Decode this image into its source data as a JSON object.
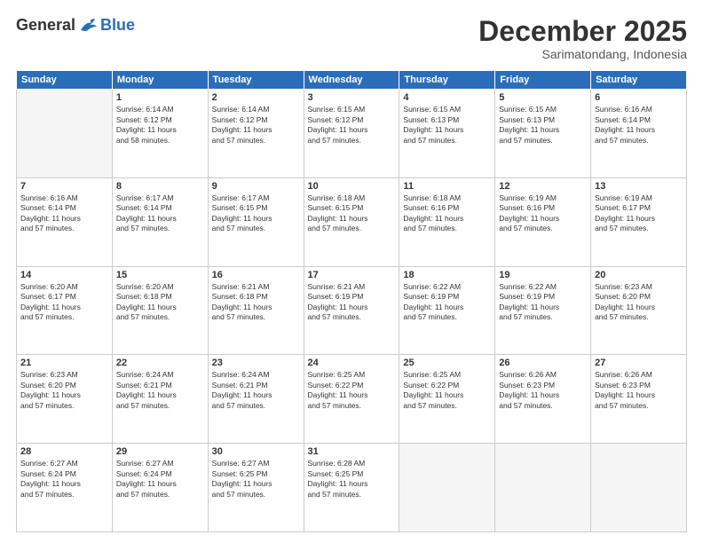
{
  "logo": {
    "general": "General",
    "blue": "Blue"
  },
  "title": "December 2025",
  "subtitle": "Sarimatondang, Indonesia",
  "weekdays": [
    "Sunday",
    "Monday",
    "Tuesday",
    "Wednesday",
    "Thursday",
    "Friday",
    "Saturday"
  ],
  "weeks": [
    [
      {
        "day": "",
        "info": ""
      },
      {
        "day": "1",
        "info": "Sunrise: 6:14 AM\nSunset: 6:12 PM\nDaylight: 11 hours\nand 58 minutes."
      },
      {
        "day": "2",
        "info": "Sunrise: 6:14 AM\nSunset: 6:12 PM\nDaylight: 11 hours\nand 57 minutes."
      },
      {
        "day": "3",
        "info": "Sunrise: 6:15 AM\nSunset: 6:12 PM\nDaylight: 11 hours\nand 57 minutes."
      },
      {
        "day": "4",
        "info": "Sunrise: 6:15 AM\nSunset: 6:13 PM\nDaylight: 11 hours\nand 57 minutes."
      },
      {
        "day": "5",
        "info": "Sunrise: 6:15 AM\nSunset: 6:13 PM\nDaylight: 11 hours\nand 57 minutes."
      },
      {
        "day": "6",
        "info": "Sunrise: 6:16 AM\nSunset: 6:14 PM\nDaylight: 11 hours\nand 57 minutes."
      }
    ],
    [
      {
        "day": "7",
        "info": "Sunrise: 6:16 AM\nSunset: 6:14 PM\nDaylight: 11 hours\nand 57 minutes."
      },
      {
        "day": "8",
        "info": "Sunrise: 6:17 AM\nSunset: 6:14 PM\nDaylight: 11 hours\nand 57 minutes."
      },
      {
        "day": "9",
        "info": "Sunrise: 6:17 AM\nSunset: 6:15 PM\nDaylight: 11 hours\nand 57 minutes."
      },
      {
        "day": "10",
        "info": "Sunrise: 6:18 AM\nSunset: 6:15 PM\nDaylight: 11 hours\nand 57 minutes."
      },
      {
        "day": "11",
        "info": "Sunrise: 6:18 AM\nSunset: 6:16 PM\nDaylight: 11 hours\nand 57 minutes."
      },
      {
        "day": "12",
        "info": "Sunrise: 6:19 AM\nSunset: 6:16 PM\nDaylight: 11 hours\nand 57 minutes."
      },
      {
        "day": "13",
        "info": "Sunrise: 6:19 AM\nSunset: 6:17 PM\nDaylight: 11 hours\nand 57 minutes."
      }
    ],
    [
      {
        "day": "14",
        "info": "Sunrise: 6:20 AM\nSunset: 6:17 PM\nDaylight: 11 hours\nand 57 minutes."
      },
      {
        "day": "15",
        "info": "Sunrise: 6:20 AM\nSunset: 6:18 PM\nDaylight: 11 hours\nand 57 minutes."
      },
      {
        "day": "16",
        "info": "Sunrise: 6:21 AM\nSunset: 6:18 PM\nDaylight: 11 hours\nand 57 minutes."
      },
      {
        "day": "17",
        "info": "Sunrise: 6:21 AM\nSunset: 6:19 PM\nDaylight: 11 hours\nand 57 minutes."
      },
      {
        "day": "18",
        "info": "Sunrise: 6:22 AM\nSunset: 6:19 PM\nDaylight: 11 hours\nand 57 minutes."
      },
      {
        "day": "19",
        "info": "Sunrise: 6:22 AM\nSunset: 6:19 PM\nDaylight: 11 hours\nand 57 minutes."
      },
      {
        "day": "20",
        "info": "Sunrise: 6:23 AM\nSunset: 6:20 PM\nDaylight: 11 hours\nand 57 minutes."
      }
    ],
    [
      {
        "day": "21",
        "info": "Sunrise: 6:23 AM\nSunset: 6:20 PM\nDaylight: 11 hours\nand 57 minutes."
      },
      {
        "day": "22",
        "info": "Sunrise: 6:24 AM\nSunset: 6:21 PM\nDaylight: 11 hours\nand 57 minutes."
      },
      {
        "day": "23",
        "info": "Sunrise: 6:24 AM\nSunset: 6:21 PM\nDaylight: 11 hours\nand 57 minutes."
      },
      {
        "day": "24",
        "info": "Sunrise: 6:25 AM\nSunset: 6:22 PM\nDaylight: 11 hours\nand 57 minutes."
      },
      {
        "day": "25",
        "info": "Sunrise: 6:25 AM\nSunset: 6:22 PM\nDaylight: 11 hours\nand 57 minutes."
      },
      {
        "day": "26",
        "info": "Sunrise: 6:26 AM\nSunset: 6:23 PM\nDaylight: 11 hours\nand 57 minutes."
      },
      {
        "day": "27",
        "info": "Sunrise: 6:26 AM\nSunset: 6:23 PM\nDaylight: 11 hours\nand 57 minutes."
      }
    ],
    [
      {
        "day": "28",
        "info": "Sunrise: 6:27 AM\nSunset: 6:24 PM\nDaylight: 11 hours\nand 57 minutes."
      },
      {
        "day": "29",
        "info": "Sunrise: 6:27 AM\nSunset: 6:24 PM\nDaylight: 11 hours\nand 57 minutes."
      },
      {
        "day": "30",
        "info": "Sunrise: 6:27 AM\nSunset: 6:25 PM\nDaylight: 11 hours\nand 57 minutes."
      },
      {
        "day": "31",
        "info": "Sunrise: 6:28 AM\nSunset: 6:25 PM\nDaylight: 11 hours\nand 57 minutes."
      },
      {
        "day": "",
        "info": ""
      },
      {
        "day": "",
        "info": ""
      },
      {
        "day": "",
        "info": ""
      }
    ]
  ]
}
